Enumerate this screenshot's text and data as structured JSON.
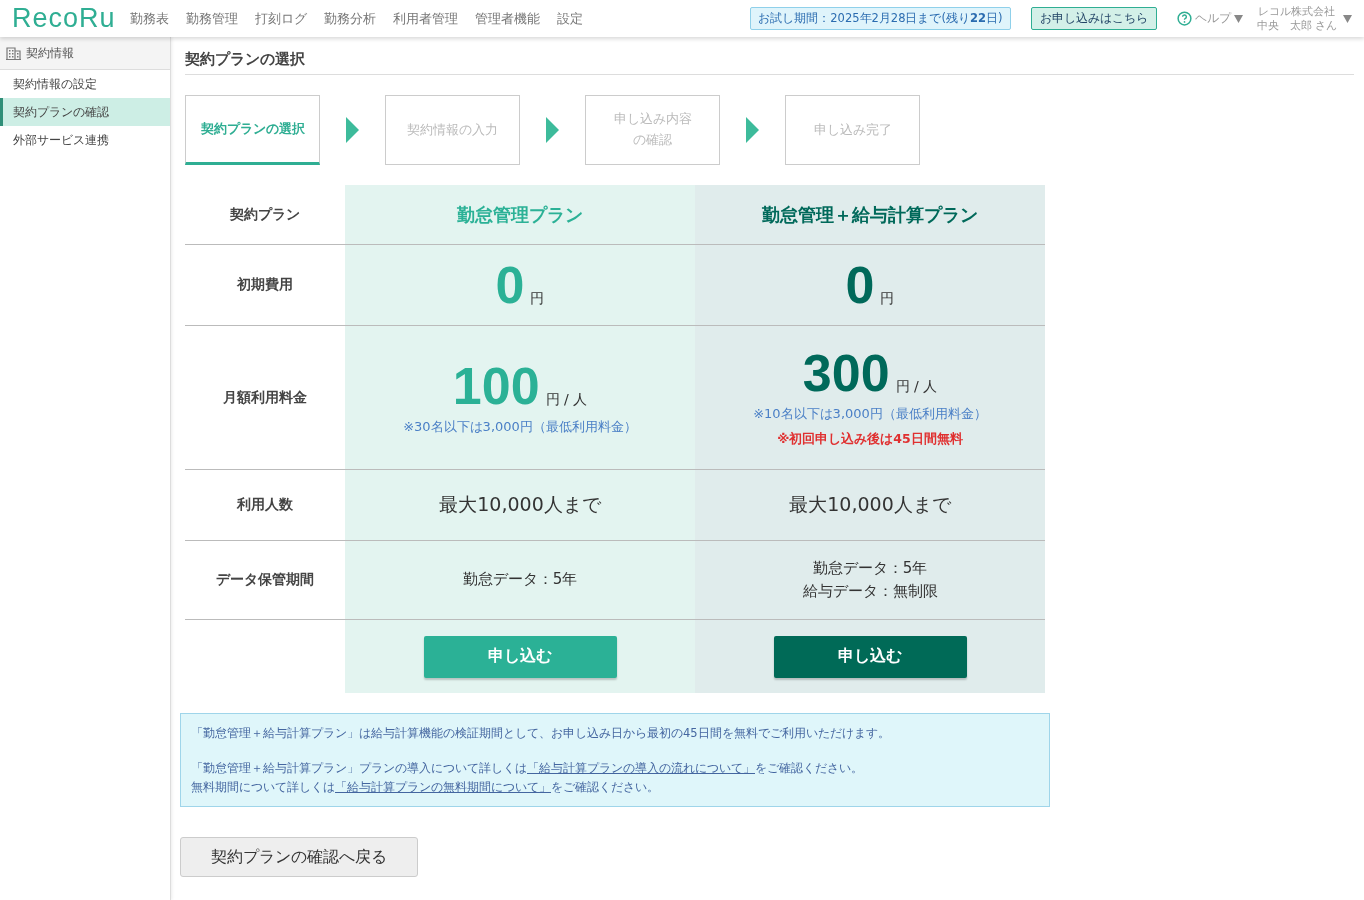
{
  "header": {
    "logo": "RecoRu",
    "nav": [
      "勤務表",
      "勤務管理",
      "打刻ログ",
      "勤務分析",
      "利用者管理",
      "管理者機能",
      "設定"
    ],
    "trial_badge": "お試し期間：2025年2月28日まで(残り**22**日)",
    "apply_button": "お申し込みはこちら",
    "help": "ヘルプ",
    "company": "レコル株式会社",
    "user": "中央　太郎 さん"
  },
  "sidebar": {
    "title": "契約情報",
    "items": [
      {
        "label": "契約情報の設定",
        "selected": false
      },
      {
        "label": "契約プランの確認",
        "selected": true
      },
      {
        "label": "外部サービス連携",
        "selected": false
      }
    ]
  },
  "page_title": "契約プランの選択",
  "steps": [
    {
      "label": "契約プランの選択",
      "selected": true
    },
    {
      "label": "契約情報の入力",
      "selected": false
    },
    {
      "label": "申し込み内容の確認",
      "selected": false
    },
    {
      "label": "申し込み完了",
      "selected": false
    }
  ],
  "plan_table": {
    "row_labels": [
      "契約プラン",
      "初期費用",
      "月額利用料金",
      "利用人数",
      "データ保管期間"
    ],
    "plans": [
      {
        "kind": "basic",
        "name": "勤怠管理プラン",
        "initial_fee": "0",
        "initial_unit": "円",
        "monthly_fee": "100",
        "monthly_unit": "円 / 人",
        "note": "※30名以下は3,000円（最低利用料金）",
        "users": "最大10,000人まで",
        "retention": [
          "勤怠データ：5年"
        ],
        "button": "申し込む"
      },
      {
        "kind": "premium",
        "name": "勤怠管理＋給与計算プラン",
        "initial_fee": "0",
        "initial_unit": "円",
        "monthly_fee": "300",
        "monthly_unit": "円 / 人",
        "note": "※10名以下は3,000円（最低利用料金）",
        "promo": "※初回申し込み後は45日間無料",
        "users": "最大10,000人まで",
        "retention": [
          "勤怠データ：5年",
          "給与データ：無制限"
        ],
        "button": "申し込む"
      }
    ]
  },
  "info": {
    "paragraph": "「勤怠管理＋給与計算プラン」は給与計算機能の検証期間として、お申し込み日から最初の45日間を無料でご利用いただけます。",
    "lines": [
      {
        "before": "「勤怠管理＋給与計算プラン」プランの導入について詳しくは",
        "link": "「給与計算プランの導入の流れについて」",
        "after": "をご確認ください。"
      },
      {
        "before": "無料期間について詳しくは",
        "link": "「給与計算プランの無料期間について」",
        "after": "をご確認ください。"
      }
    ]
  },
  "back_button": "契約プランの確認へ戻る"
}
